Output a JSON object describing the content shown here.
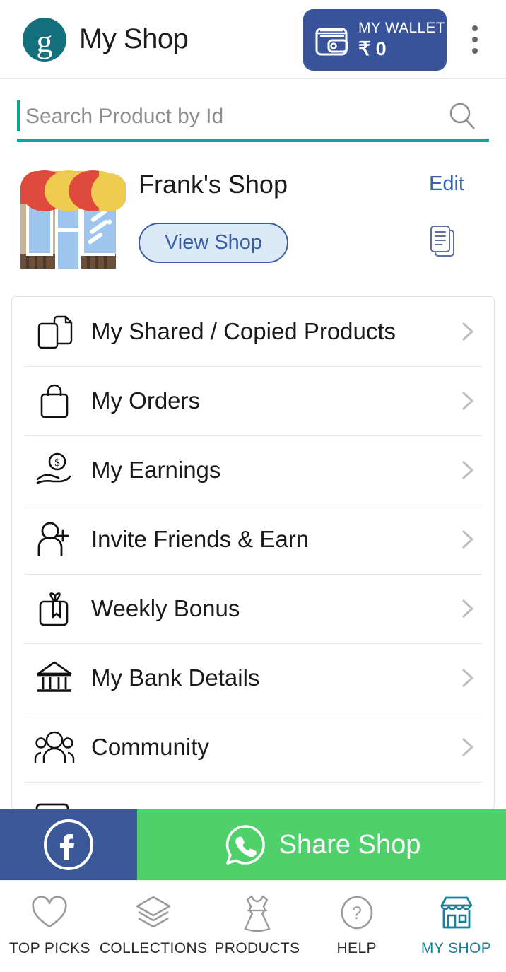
{
  "header": {
    "logo_letter": "g",
    "logo_color": "#14707d",
    "title": "My Shop",
    "wallet": {
      "label": "MY WALLET",
      "amount": "₹ 0",
      "bg_color": "#39539b",
      "icon": "wallet-icon"
    },
    "overflow_icon": "kebab-menu-icon"
  },
  "search": {
    "placeholder": "Search Product by Id",
    "value": "",
    "icon": "search-icon",
    "accent_color": "#00a99d"
  },
  "shop": {
    "name": "Frank's Shop",
    "edit_label": "Edit",
    "view_shop_label": "View Shop",
    "thumbnail_icon": "storefront-illustration",
    "copy_icon": "copy-documents-icon",
    "link_color": "#3a63ae"
  },
  "menu": {
    "items": [
      {
        "label": "My Shared / Copied Products",
        "icon": "copy-pages-icon"
      },
      {
        "label": "My Orders",
        "icon": "shopping-bag-icon"
      },
      {
        "label": "My Earnings",
        "icon": "hand-coin-icon"
      },
      {
        "label": "Invite Friends & Earn",
        "icon": "person-add-icon"
      },
      {
        "label": "Weekly Bonus",
        "icon": "gift-box-icon"
      },
      {
        "label": "My Bank Details",
        "icon": "bank-building-icon"
      },
      {
        "label": "Community",
        "icon": "people-group-icon"
      },
      {
        "label": "",
        "icon": "chat-bubble-icon"
      }
    ],
    "chevron_icon": "chevron-right-icon"
  },
  "share_bar": {
    "facebook": {
      "icon": "facebook-icon",
      "bg_color": "#3b5998"
    },
    "whatsapp": {
      "icon": "whatsapp-icon",
      "label": "Share Shop",
      "bg_color": "#4fd06a"
    }
  },
  "bottom_nav": {
    "active_color": "#1b7f95",
    "items": [
      {
        "label": "TOP PICKS",
        "icon": "heart-icon",
        "active": false
      },
      {
        "label": "COLLECTIONS",
        "icon": "layers-icon",
        "active": false
      },
      {
        "label": "PRODUCTS",
        "icon": "dress-icon",
        "active": false
      },
      {
        "label": "HELP",
        "icon": "question-circle-icon",
        "active": false
      },
      {
        "label": "MY SHOP",
        "icon": "storefront-icon",
        "active": true
      }
    ]
  }
}
